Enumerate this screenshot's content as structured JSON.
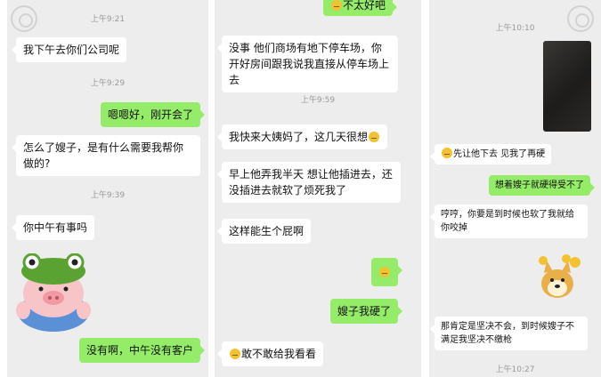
{
  "panel1": {
    "time_top": "上午9:21",
    "msg1": "我下午去你们公司呢",
    "time2": "上午9:29",
    "msg2": "嗯嗯好，刚开会了",
    "msg3": "怎么了嫂子，是有什么需要我帮你做的?",
    "time3": "上午9:39",
    "msg4": "你中午有事吗",
    "sticker": "pig-frog-hat-sticker",
    "msg5": "没有啊，中午没有客户"
  },
  "panel2": {
    "msg_top": "不太好吧",
    "msg1": "没事 他们商场有地下停车场，你开好房间跟我说我直接从停车场上去",
    "time1": "上午9:59",
    "msg2": "我快来大姨妈了，这几天很想",
    "msg3": "早上他弄我半天 想让他插进去，还没插进去就软了烦死我了",
    "msg4": "这样能生个屁啊",
    "msg5_emoji": "emoji-sticker",
    "msg6": "嫂子我硬了",
    "msg7": "敢不敢给我看看"
  },
  "panel3": {
    "time1": "上午10:10",
    "photo": "dark-photo",
    "msg1": "先让他下去 见我了再硬",
    "msg2": "想着嫂子就硬得受不了",
    "msg3": "哼哼，你要是到时候也软了我就给你咬掉",
    "sticker": "doge-sticker",
    "msg4": "那肯定是坚决不会，到时候嫂子不满足我坚决不缴枪",
    "time2": "上午10:27"
  },
  "colors": {
    "sent": "#95ec69",
    "received": "#ffffff",
    "background": "#ededed"
  }
}
